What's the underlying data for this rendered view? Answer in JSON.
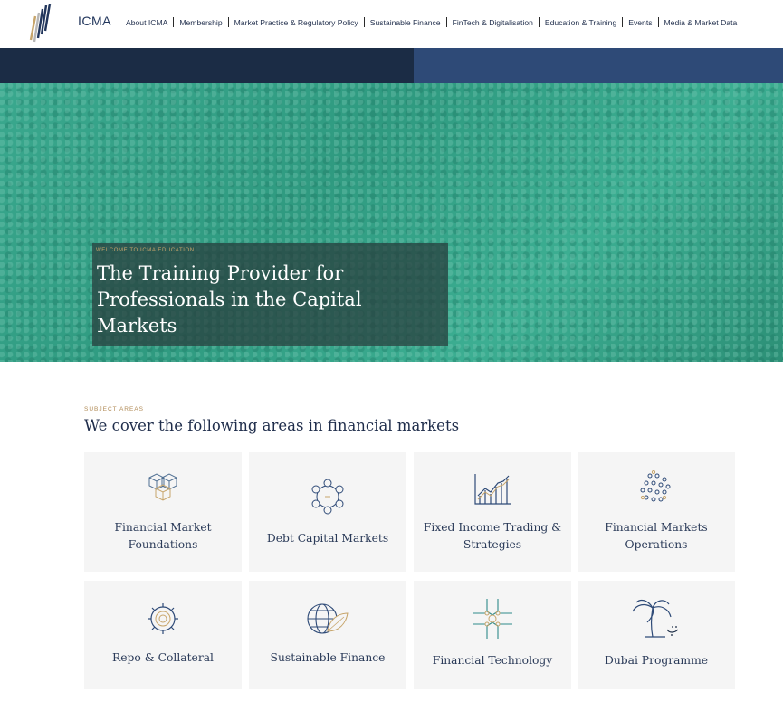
{
  "brand": {
    "name": "ICMA"
  },
  "nav": {
    "items": [
      "About ICMA",
      "Membership",
      "Market Practice & Regulatory Policy",
      "Sustainable Finance",
      "FinTech & Digitalisation",
      "Education & Training",
      "Events",
      "Media & Market Data"
    ]
  },
  "hero": {
    "eyebrow": "WELCOME TO ICMA EDUCATION",
    "title": "The Training Provider for Professionals in the Capital Markets"
  },
  "subjects": {
    "eyebrow": "SUBJECT AREAS",
    "title": "We cover the following areas in financial markets",
    "cards": [
      {
        "label": "Financial Market Foundations",
        "icon": "cubes-icon"
      },
      {
        "label": "Debt Capital Markets",
        "icon": "network-icon"
      },
      {
        "label": "Fixed Income Trading & Strategies",
        "icon": "line-chart-icon"
      },
      {
        "label": "Financial Markets Operations",
        "icon": "dots-icon"
      },
      {
        "label": "Repo & Collateral",
        "icon": "gear-icon"
      },
      {
        "label": "Sustainable Finance",
        "icon": "globe-leaf-icon"
      },
      {
        "label": "Financial Technology",
        "icon": "circuit-icon"
      },
      {
        "label": "Dubai Programme",
        "icon": "palm-tree-icon"
      }
    ]
  },
  "colors": {
    "navy": "#1b2c45",
    "blue": "#2e4a77",
    "gold": "#c7a56b",
    "card_bg": "#f5f5f5"
  }
}
